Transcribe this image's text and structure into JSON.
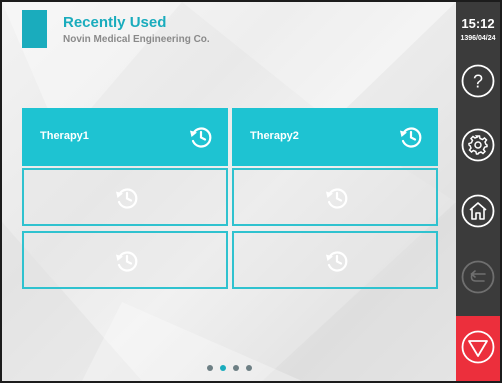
{
  "header": {
    "title": "Recently Used",
    "subtitle": "Novin Medical Engineering Co."
  },
  "tiles": [
    {
      "label": "Therapy1",
      "filled": true,
      "icon": "history-icon"
    },
    {
      "label": "Therapy2",
      "filled": true,
      "icon": "history-icon"
    },
    {
      "label": "",
      "filled": false,
      "icon": "history-icon"
    },
    {
      "label": "",
      "filled": false,
      "icon": "history-icon"
    },
    {
      "label": "",
      "filled": false,
      "icon": "history-icon"
    },
    {
      "label": "",
      "filled": false,
      "icon": "history-icon"
    }
  ],
  "pagination": {
    "pages": 4,
    "active_page": 2
  },
  "sidebar": {
    "time": "15:12",
    "date": "1396/04/24",
    "buttons": [
      "help-icon",
      "settings-icon",
      "home-icon",
      "back-icon"
    ],
    "back_enabled": false,
    "stop": "stop-icon"
  },
  "colors": {
    "accent": "#1aacbd",
    "tile_fill": "#1ec3d2",
    "sidebar": "#3b3b3b",
    "stop": "#ec2f3c"
  }
}
